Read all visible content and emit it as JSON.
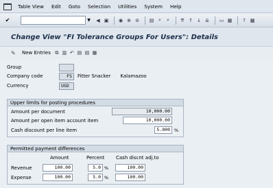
{
  "menubar": {
    "items": [
      "Table View",
      "Edit",
      "Goto",
      "Selection",
      "Utilities",
      "System",
      "Help"
    ]
  },
  "toolbar": {
    "command_field": "",
    "icons": [
      "back-icon",
      "exit-icon",
      "cancel-icon",
      "print-icon",
      "find-icon",
      "find-next-icon",
      "first-page-icon",
      "prev-page-icon",
      "next-page-icon",
      "last-page-icon",
      "create-session-icon",
      "shortcut-icon",
      "help-icon",
      "layout-icon"
    ]
  },
  "title": "Change View \"FI Tolerance Groups For Users\": Details",
  "app_toolbar": {
    "new_entries": "New Entries",
    "icons": [
      "copy-icon",
      "delete-icon",
      "undo-icon",
      "prev-entry-icon",
      "next-entry-icon",
      "select-all-icon"
    ]
  },
  "header": {
    "group_label": "Group",
    "group_value": "",
    "company_code_label": "Company code",
    "company_code_value": "FS",
    "company_name": "Fitter Snacker",
    "company_city": "Kalamazoo",
    "currency_label": "Currency",
    "currency_value": "USD"
  },
  "upper_limits": {
    "title": "Upper limits for posting procedures",
    "amount_per_document_label": "Amount per document",
    "amount_per_document_value": "10,000.00",
    "amount_per_item_label": "Amount per open item account item",
    "amount_per_item_value": "10,000.00",
    "cash_discount_label": "Cash discount per line item",
    "cash_discount_value": "5.000",
    "cash_discount_unit": "%"
  },
  "permitted": {
    "title": "Permitted payment differences",
    "col_amount": "Amount",
    "col_percent": "Percent",
    "col_cash": "Cash discnt adj.to",
    "rows": [
      {
        "label": "Revenue",
        "amount": "100.00",
        "percent": "5.0",
        "unit": "%",
        "cash": "100.00"
      },
      {
        "label": "Expense",
        "amount": "100.00",
        "percent": "5.0",
        "unit": "%",
        "cash": "100.00"
      }
    ]
  }
}
